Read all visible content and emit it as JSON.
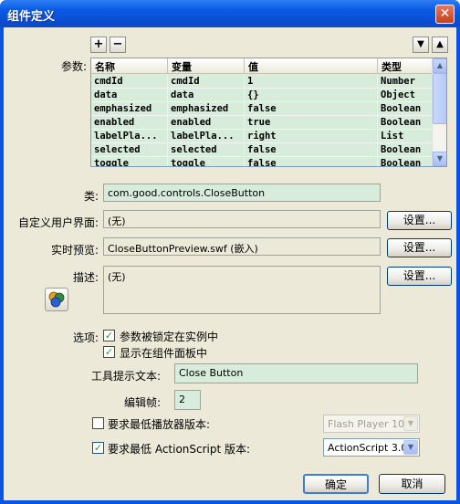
{
  "window": {
    "title": "组件定义",
    "close_glyph": "✕"
  },
  "toolbar": {
    "add_label": "+",
    "remove_label": "−",
    "move_down_glyph": "▼",
    "move_up_glyph": "▲"
  },
  "params": {
    "label": "参数:",
    "columns": [
      "名称",
      "变量",
      "值",
      "类型"
    ],
    "rows": [
      [
        "cmdId",
        "cmdId",
        "1",
        "Number"
      ],
      [
        "data",
        "data",
        "{}",
        "Object"
      ],
      [
        "emphasized",
        "emphasized",
        "false",
        "Boolean"
      ],
      [
        "enabled",
        "enabled",
        "true",
        "Boolean"
      ],
      [
        "labelPla...",
        "labelPla...",
        "right",
        "List"
      ],
      [
        "selected",
        "selected",
        "false",
        "Boolean"
      ],
      [
        "toggle",
        "toggle",
        "false",
        "Boolean"
      ]
    ]
  },
  "class": {
    "label": "类:",
    "value": "com.good.controls.CloseButton"
  },
  "custom_ui": {
    "label": "自定义用户界面:",
    "value": "(无)",
    "button": "设置..."
  },
  "live_preview": {
    "label": "实时预览:",
    "value": "CloseButtonPreview.swf (嵌入)",
    "button": "设置..."
  },
  "description": {
    "label": "描述:",
    "value": "(无)",
    "button": "设置..."
  },
  "options": {
    "label": "选项:",
    "lock_params": {
      "label": "参数被锁定在实例中",
      "checked": true
    },
    "show_in_panel": {
      "label": "显示在组件面板中",
      "checked": true
    },
    "tooltip": {
      "label": "工具提示文本:",
      "value": "Close Button"
    },
    "edit_frame": {
      "label": "编辑帧:",
      "value": "2"
    },
    "min_player": {
      "label": "要求最低播放器版本:",
      "checked": false,
      "value": "Flash Player 10"
    },
    "min_as": {
      "label": "要求最低 ActionScript 版本:",
      "checked": true,
      "value": "ActionScript 3.0"
    }
  },
  "buttons": {
    "ok": "确定",
    "cancel": "取消"
  },
  "icons": {
    "close": "close-icon",
    "description_icon": "component-icon"
  }
}
